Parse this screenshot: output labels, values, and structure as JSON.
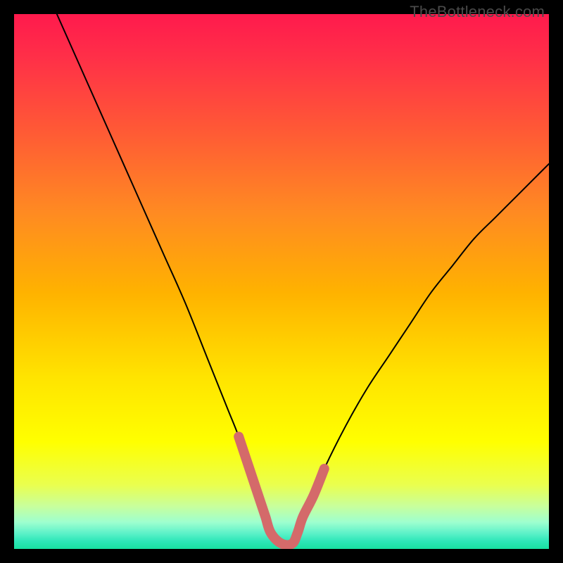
{
  "watermark": "TheBottleneck.com",
  "chart_data": {
    "type": "line",
    "title": "",
    "xlabel": "",
    "ylabel": "",
    "xlim": [
      0,
      100
    ],
    "ylim": [
      0,
      100
    ],
    "grid": false,
    "legend": false,
    "series": [
      {
        "name": "main-curve",
        "color": "#000000",
        "stroke_width": 2,
        "x": [
          8,
          12,
          16,
          20,
          24,
          28,
          32,
          36,
          38,
          40,
          42,
          44,
          46,
          47,
          48,
          50,
          52,
          53,
          54,
          56,
          58,
          62,
          66,
          70,
          74,
          78,
          82,
          86,
          90,
          94,
          98,
          100
        ],
        "y": [
          100,
          91,
          82,
          73,
          64,
          55,
          46,
          36,
          31,
          26,
          21,
          15,
          9,
          6,
          3,
          1,
          1,
          3,
          6,
          10,
          15,
          23,
          30,
          36,
          42,
          48,
          53,
          58,
          62,
          66,
          70,
          72
        ]
      },
      {
        "name": "bottom-highlight",
        "color": "#d46a6a",
        "stroke_width": 14,
        "x": [
          42,
          44,
          46,
          47,
          48,
          50,
          52,
          53,
          54,
          56,
          58
        ],
        "y": [
          21,
          15,
          9,
          6,
          3,
          1,
          1,
          3,
          6,
          10,
          15
        ]
      }
    ],
    "annotations": [
      {
        "text": "TheBottleneck.com",
        "position": "top-right",
        "color": "#4a4a4a"
      }
    ]
  }
}
